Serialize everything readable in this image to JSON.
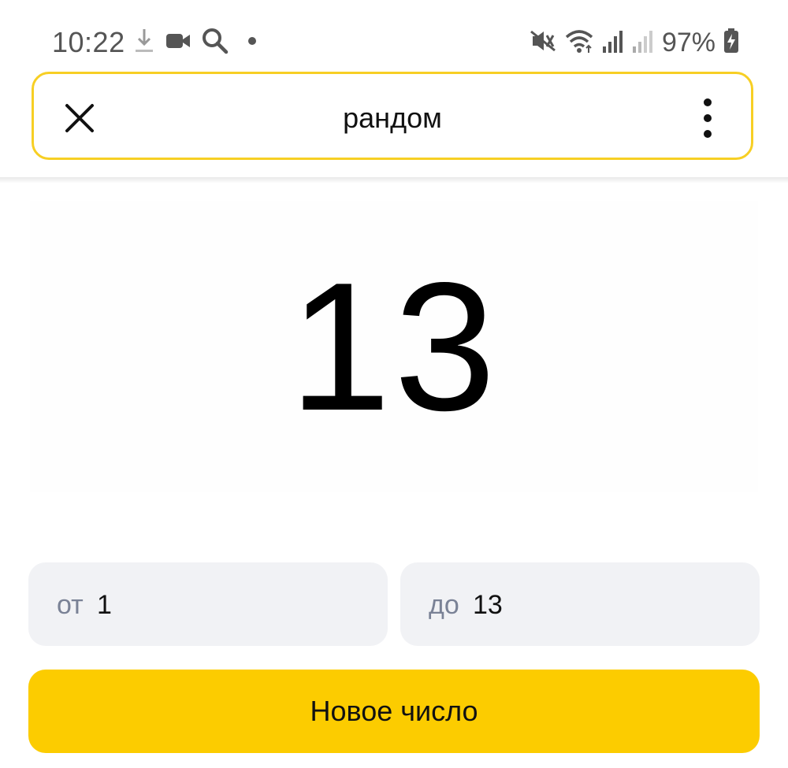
{
  "status_bar": {
    "time": "10:22",
    "battery_percent": "97%",
    "icons": [
      "download-icon",
      "video-camera-icon",
      "search-icon",
      "notification-dot-icon",
      "vibrate-mute-icon",
      "wifi-icon",
      "signal-icon",
      "signal-weak-icon",
      "battery-charging-icon"
    ]
  },
  "search_bar": {
    "query": "рандом",
    "close_icon": "close-icon",
    "menu_icon": "more-vertical-icon",
    "border_color": "#f7cf24"
  },
  "result": {
    "number": "13"
  },
  "range": {
    "from_label": "от",
    "from_value": "1",
    "to_label": "до",
    "to_value": "13"
  },
  "action": {
    "label": "Новое число",
    "color": "#fccc00"
  }
}
